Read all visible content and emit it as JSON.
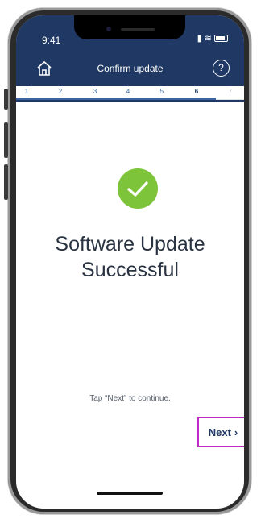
{
  "status": {
    "time": "9:41"
  },
  "header": {
    "title": "Confirm update",
    "help_label": "?"
  },
  "steps": [
    {
      "label": "1",
      "state": "done"
    },
    {
      "label": "2",
      "state": "done"
    },
    {
      "label": "3",
      "state": "done"
    },
    {
      "label": "4",
      "state": "done"
    },
    {
      "label": "5",
      "state": "done"
    },
    {
      "label": "6",
      "state": "active"
    },
    {
      "label": "7",
      "state": "future"
    }
  ],
  "main": {
    "message_line1": "Software Update",
    "message_line2": "Successful",
    "instruction": "Tap “Next” to continue.",
    "next_label": "Next",
    "next_icon": "chevron-right-icon"
  },
  "colors": {
    "header_bg": "#1f3864",
    "success_green": "#7ec43a",
    "highlight_border": "#c02ac6"
  }
}
